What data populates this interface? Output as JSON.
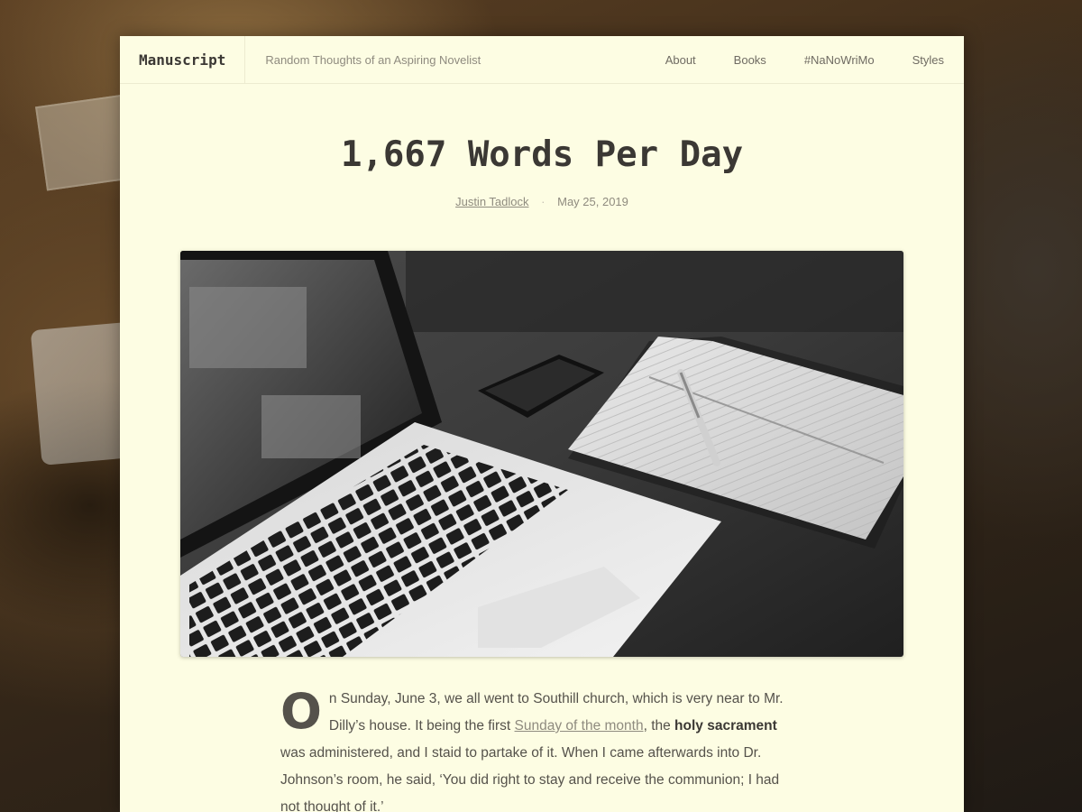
{
  "site": {
    "title": "Manuscript",
    "tagline": "Random Thoughts of an Aspiring Novelist"
  },
  "nav": {
    "items": [
      {
        "label": "About"
      },
      {
        "label": "Books"
      },
      {
        "label": "#NaNoWriMo"
      },
      {
        "label": "Styles"
      }
    ]
  },
  "post": {
    "title": "1,667 Words Per Day",
    "author": "Justin Tadlock",
    "date": "May 25, 2019",
    "separator": "·",
    "dropcap": "O",
    "body": {
      "part1": "n Sunday, June 3, we all went to Southill church, which is very near to Mr. Dilly’s house. It being the first ",
      "link": "Sunday of the month",
      "part2": ", the ",
      "bold": "holy sacrament",
      "part3": " was administered, and I staid to partake of it. When I came afterwards into Dr. Johnson’s room, he said, ‘You did right to stay and receive the communion; I had not thought of it.’"
    }
  },
  "colors": {
    "page_bg": "#fdfde3",
    "title": "#3b3834",
    "muted": "#8f8b7f"
  }
}
